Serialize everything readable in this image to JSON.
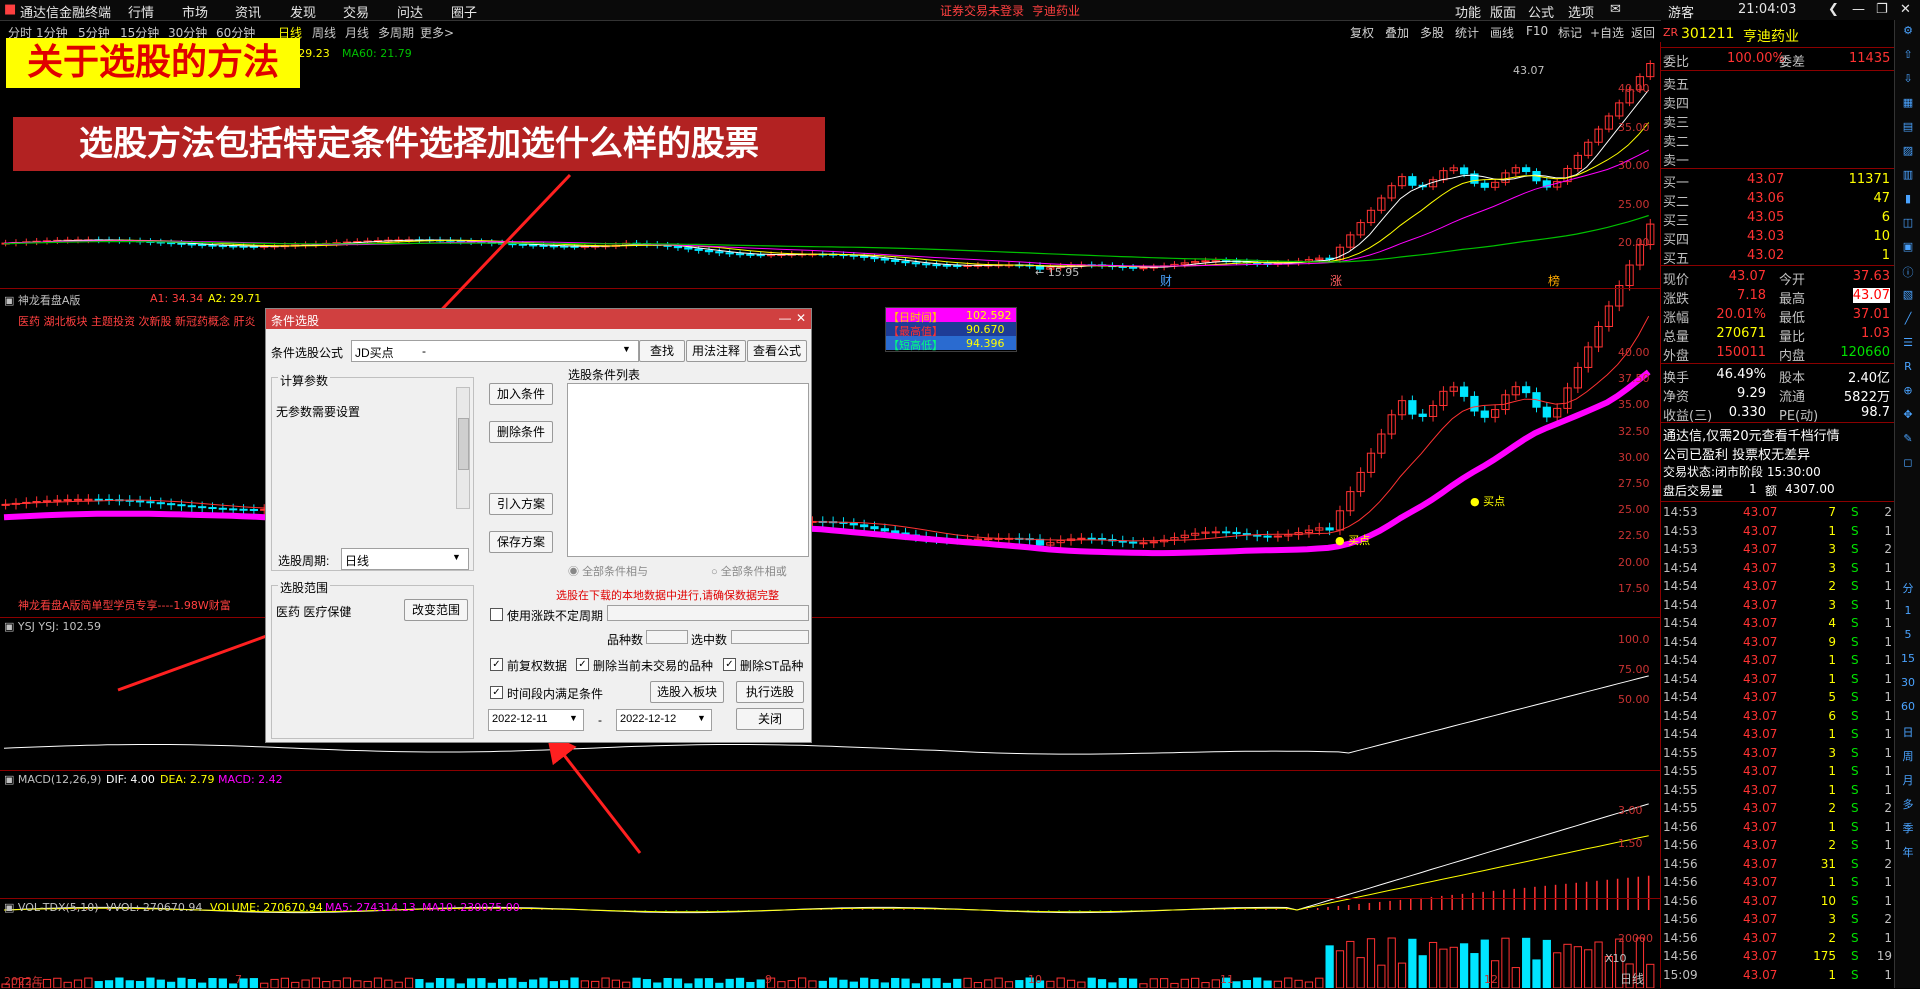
{
  "menubar": {
    "app_name": "通达信金融终端",
    "menus": [
      "行情",
      "市场",
      "资讯",
      "发现",
      "交易",
      "问达",
      "圈子"
    ],
    "notice": "证券交易未登录",
    "stock_notice": "亨迪药业",
    "right_items": [
      "功能",
      "版面",
      "公式",
      "选项"
    ],
    "user": "游客",
    "time": "21:04:03"
  },
  "periods": [
    "分时",
    "1分钟",
    "5分钟",
    "15分钟",
    "30分钟",
    "60分钟",
    "日线",
    "周线",
    "月线",
    "多周期",
    "更多>"
  ],
  "active_period": "日线",
  "chart_toolbar": [
    "复权",
    "叠加",
    "多股",
    "统计",
    "画线",
    "F10",
    "标记",
    "+自选",
    "返回"
  ],
  "banners": {
    "title": "关于选股的方法",
    "subtitle": "选股方法包括特定条件选择加选什么样的股票"
  },
  "main_panel": {
    "ma_text": "0: 29.23",
    "ma60_text": "MA60: 21.79",
    "high_label": "43.07",
    "low_label": "15.95",
    "y_ticks": [
      "40.00",
      "35.00",
      "30.00",
      "25.00",
      "20.00"
    ],
    "markers": [
      "财",
      "涨",
      "榜"
    ]
  },
  "dragon_panel": {
    "name": "神龙看盘A版",
    "a1": "A1: 34.34",
    "a2": "A2: 29.71",
    "tags": "医药 湖北板块 主题投资 次新股 新冠药概念 肝炎",
    "footer": "神龙看盘A版简单型学员专享----1.98W财富",
    "legend": [
      "【日时间】",
      "【最高值】",
      "【短高低】"
    ],
    "legend_values": [
      "102.592",
      "90.670",
      "94.396"
    ],
    "buy_label": "买点",
    "y_ticks": [
      "40.00",
      "37.50",
      "35.00",
      "32.50",
      "30.00",
      "27.50",
      "25.00",
      "22.50",
      "20.00",
      "17.50"
    ]
  },
  "ysj_panel": {
    "title": "YSJ  YSJ: 102.59",
    "y_ticks": [
      "100.0",
      "75.00",
      "50.00"
    ]
  },
  "macd_panel": {
    "title": "MACD(12,26,9)",
    "dif": "DIF: 4.00",
    "dea": "DEA: 2.79",
    "macd": "MACD: 2.42",
    "y_ticks": [
      "3.00",
      "1.50"
    ]
  },
  "vol_panel": {
    "title": "VOL-TDX(5,10)",
    "vvol": "VVOL: 270670.94",
    "volume": "VOLUME: 270670.94",
    "ma5": "MA5: 274314.13",
    "ma10": "MA10: 230075.00",
    "y_tick": "20000",
    "unit": "X10",
    "x_labels": [
      "2022年",
      "7",
      "9",
      "10",
      "11",
      "12"
    ],
    "footer_label": "日线"
  },
  "dialog": {
    "title": "条件选股",
    "formula_label": "条件选股公式",
    "formula_value": "JD买点",
    "formula_suffix": "-",
    "find_btn": "查找",
    "usage_btn": "用法注释",
    "view_btn": "查看公式",
    "params_group": "计算参数",
    "params_text": "无参数需要设置",
    "add_btn": "加入条件",
    "delete_btn": "删除条件",
    "import_btn": "引入方案",
    "save_btn": "保存方案",
    "list_label": "选股条件列表",
    "radio_and": "全部条件相与",
    "radio_or": "全部条件相或",
    "period_label": "选股周期:",
    "period_value": "日线",
    "range_group": "选股范围",
    "range_text": "医药 医疗保健",
    "change_range_btn": "改变范围",
    "warning": "选股在下载的本地数据中进行,请确保数据完整",
    "use_period": "使用涨跌不定周期",
    "count_label": "品种数",
    "selected_label": "选中数",
    "fq_label": "前复权数据",
    "remove_untraded": "删除当前未交易的品种",
    "remove_st": "删除ST品种",
    "time_range": "时间段内满足条件",
    "to_block_btn": "选股入板块",
    "run_btn": "执行选股",
    "start_date": "2022-12-11",
    "dash": "-",
    "end_date": "2022-12-12",
    "close_btn": "关闭"
  },
  "quote": {
    "tag": "ZR",
    "code": "301211",
    "name": "亨迪药业",
    "weibi_label": "委比",
    "weibi": "100.00%",
    "weicha_label": "委差",
    "weicha": "11435",
    "sells": [
      "卖五",
      "卖四",
      "卖三",
      "卖二",
      "卖一"
    ],
    "buys": [
      {
        "label": "买一",
        "price": "43.07",
        "vol": "11371"
      },
      {
        "label": "买二",
        "price": "43.06",
        "vol": "47"
      },
      {
        "label": "买三",
        "price": "43.05",
        "vol": "6"
      },
      {
        "label": "买四",
        "price": "43.03",
        "vol": "10"
      },
      {
        "label": "买五",
        "price": "43.02",
        "vol": "1"
      }
    ],
    "stats": [
      {
        "l1": "现价",
        "v1": "43.07",
        "l2": "今开",
        "v2": "37.63"
      },
      {
        "l1": "涨跌",
        "v1": "7.18",
        "l2": "最高",
        "v2": "43.07"
      },
      {
        "l1": "涨幅",
        "v1": "20.01%",
        "l2": "最低",
        "v2": "37.01"
      },
      {
        "l1": "总量",
        "v1": "270671",
        "l2": "量比",
        "v2": "1.03"
      },
      {
        "l1": "外盘",
        "v1": "150011",
        "l2": "内盘",
        "v2": "120660"
      }
    ],
    "stats2": [
      {
        "l1": "换手",
        "v1": "46.49%",
        "l2": "股本",
        "v2": "2.40亿"
      },
      {
        "l1": "净资",
        "v1": "9.29",
        "l2": "流通",
        "v2": "5822万"
      },
      {
        "l1": "收益(三)",
        "v1": "0.330",
        "l2": "PE(动)",
        "v2": "98.7"
      }
    ],
    "info1": "通达信,仅需20元查看千档行情",
    "info2": "公司已盈利 投票权无差异",
    "info3": "交易状态:闭市阶段 15:30:00",
    "info4_label": "盘后交易量",
    "info4_v1": "1",
    "info4_l2": "额",
    "info4_v2": "4307.00"
  },
  "ticks": [
    [
      "14:53",
      "43.07",
      "7",
      "S",
      "2"
    ],
    [
      "14:53",
      "43.07",
      "1",
      "S",
      "1"
    ],
    [
      "14:53",
      "43.07",
      "3",
      "S",
      "2"
    ],
    [
      "14:54",
      "43.07",
      "3",
      "S",
      "1"
    ],
    [
      "14:54",
      "43.07",
      "2",
      "S",
      "1"
    ],
    [
      "14:54",
      "43.07",
      "3",
      "S",
      "1"
    ],
    [
      "14:54",
      "43.07",
      "4",
      "S",
      "1"
    ],
    [
      "14:54",
      "43.07",
      "9",
      "S",
      "1"
    ],
    [
      "14:54",
      "43.07",
      "1",
      "S",
      "1"
    ],
    [
      "14:54",
      "43.07",
      "1",
      "S",
      "1"
    ],
    [
      "14:54",
      "43.07",
      "5",
      "S",
      "1"
    ],
    [
      "14:54",
      "43.07",
      "6",
      "S",
      "1"
    ],
    [
      "14:54",
      "43.07",
      "1",
      "S",
      "1"
    ],
    [
      "14:55",
      "43.07",
      "3",
      "S",
      "1"
    ],
    [
      "14:55",
      "43.07",
      "1",
      "S",
      "1"
    ],
    [
      "14:55",
      "43.07",
      "1",
      "S",
      "1"
    ],
    [
      "14:55",
      "43.07",
      "2",
      "S",
      "2"
    ],
    [
      "14:56",
      "43.07",
      "1",
      "S",
      "1"
    ],
    [
      "14:56",
      "43.07",
      "2",
      "S",
      "1"
    ],
    [
      "14:56",
      "43.07",
      "31",
      "S",
      "2"
    ],
    [
      "14:56",
      "43.07",
      "1",
      "S",
      "1"
    ],
    [
      "14:56",
      "43.07",
      "10",
      "S",
      "1"
    ],
    [
      "14:56",
      "43.07",
      "3",
      "S",
      "2"
    ],
    [
      "14:56",
      "43.07",
      "2",
      "S",
      "1"
    ],
    [
      "14:56",
      "43.07",
      "175",
      "S",
      "19"
    ],
    [
      "15:09",
      "43.07",
      "1",
      "S",
      "1"
    ]
  ],
  "right_toolbar": [
    "分",
    "1",
    "5",
    "15",
    "30",
    "60",
    "日",
    "周",
    "月",
    "多",
    "季",
    "年"
  ],
  "colors": {
    "up": "#ff3232",
    "down": "#00e5ff",
    "ma5": "#ffffff",
    "ma10": "#ffff00",
    "ma20": "#ff00ff",
    "ma60": "#00c000"
  }
}
